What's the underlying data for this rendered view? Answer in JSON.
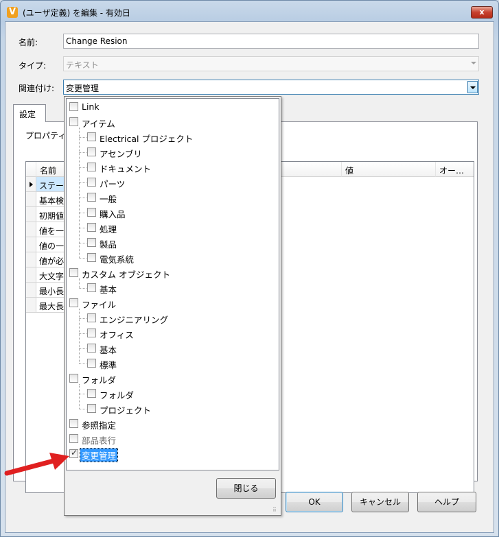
{
  "window": {
    "title": "(ユーザ定義) を編集 - 有効日",
    "app_icon": "V",
    "close_label": "x"
  },
  "form": {
    "name_label": "名前:",
    "name_value": "Change Resion",
    "type_label": "タイプ:",
    "type_value": "テキスト",
    "assoc_label": "関連付け:",
    "assoc_value": "変更管理"
  },
  "tab": {
    "label": "設定",
    "section_label": "プロパティ"
  },
  "grid": {
    "headers": [
      "名前",
      "値",
      "オー…"
    ],
    "rows": [
      "ステー",
      "基本検",
      "初期値",
      "値を一",
      "値の一",
      "値が必",
      "大文字",
      "最小長",
      "最大長"
    ]
  },
  "tree": {
    "items": [
      {
        "label": "Link",
        "level": 0,
        "checked": false
      },
      {
        "label": "アイテム",
        "level": 0,
        "checked": false
      },
      {
        "label": "Electrical プロジェクト",
        "level": 1,
        "checked": false
      },
      {
        "label": "アセンブリ",
        "level": 1,
        "checked": false
      },
      {
        "label": "ドキュメント",
        "level": 1,
        "checked": false
      },
      {
        "label": "パーツ",
        "level": 1,
        "checked": false
      },
      {
        "label": "一般",
        "level": 1,
        "checked": false
      },
      {
        "label": "購入品",
        "level": 1,
        "checked": false
      },
      {
        "label": "処理",
        "level": 1,
        "checked": false
      },
      {
        "label": "製品",
        "level": 1,
        "checked": false
      },
      {
        "label": "電気系統",
        "level": 1,
        "checked": false
      },
      {
        "label": "カスタム オブジェクト",
        "level": 0,
        "checked": false
      },
      {
        "label": "基本",
        "level": 1,
        "checked": false
      },
      {
        "label": "ファイル",
        "level": 0,
        "checked": false
      },
      {
        "label": "エンジニアリング",
        "level": 1,
        "checked": false
      },
      {
        "label": "オフィス",
        "level": 1,
        "checked": false
      },
      {
        "label": "基本",
        "level": 1,
        "checked": false
      },
      {
        "label": "標準",
        "level": 1,
        "checked": false
      },
      {
        "label": "フォルダ",
        "level": 0,
        "checked": false
      },
      {
        "label": "フォルダ",
        "level": 1,
        "checked": false
      },
      {
        "label": "プロジェクト",
        "level": 1,
        "checked": false
      },
      {
        "label": "参照指定",
        "level": 0,
        "checked": false
      },
      {
        "label": "部品表行",
        "level": 0,
        "checked": false,
        "dim": true
      },
      {
        "label": "変更管理",
        "level": 0,
        "checked": true,
        "selected": true
      }
    ],
    "close_button": "閉じる"
  },
  "buttons": {
    "ok": "OK",
    "cancel": "キャンセル",
    "help": "ヘルプ"
  },
  "annotation": {
    "arrow_color": "#e02020"
  }
}
